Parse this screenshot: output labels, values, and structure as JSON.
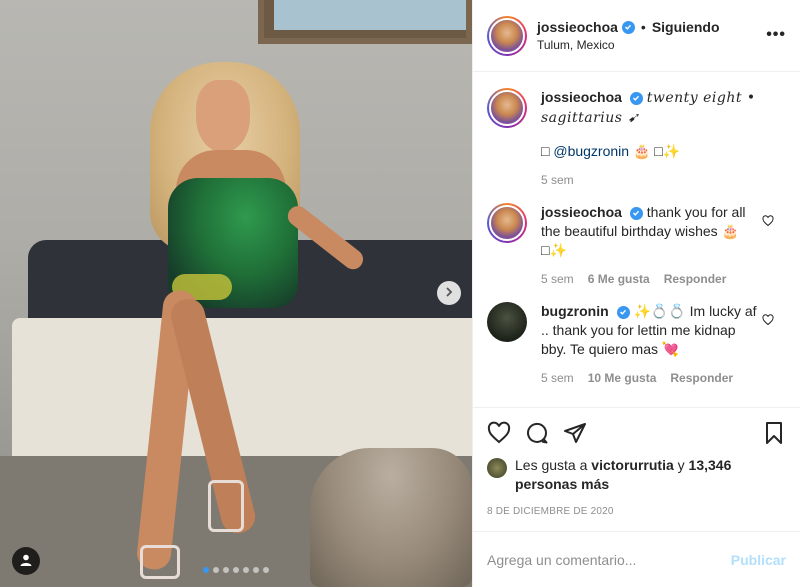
{
  "post": {
    "username": "jossieochoa",
    "follow_status": "Siguiendo",
    "separator": "•",
    "location": "Tulum, Mexico",
    "more_label": "•••"
  },
  "caption": {
    "username": "jossieochoa",
    "text": "twenty eight • sagittarius ➹",
    "line2_prefix": "□",
    "mention": "@bugzronin",
    "line2_suffix": "🎂 □✨",
    "time": "5 sem"
  },
  "comments": [
    {
      "username": "jossieochoa",
      "text": "thank you for all the beautiful birthday wishes 🎂 □✨",
      "time": "5 sem",
      "likes": "6 Me gusta",
      "reply": "Responder"
    },
    {
      "username": "bugzronin",
      "text": "✨💍💍 Im lucky af .. thank you for lettin me kidnap bby. Te quiero mas 💘",
      "time": "5 sem",
      "likes": "10 Me gusta",
      "reply": "Responder"
    }
  ],
  "likes": {
    "prefix": "Les gusta a",
    "user": "victorurrutia",
    "connector": "y",
    "count": "13,346 personas más"
  },
  "date": "8 DE DICIEMBRE DE 2020",
  "comment_box": {
    "placeholder": "Agrega un comentario...",
    "publish": "Publicar"
  },
  "carousel": {
    "total": 7,
    "active": 0
  },
  "colors": {
    "verified": "#3897f0",
    "link": "#00376b",
    "muted": "#8e8e8e",
    "publish_disabled": "#b2dffc"
  },
  "icons": [
    "verified-icon",
    "more-icon",
    "heart-icon",
    "comment-icon",
    "share-icon",
    "bookmark-icon",
    "chevron-right-icon",
    "user-tag-icon"
  ]
}
